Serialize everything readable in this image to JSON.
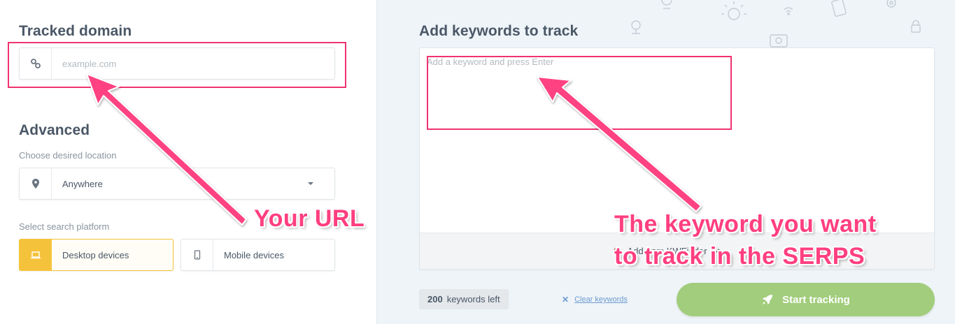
{
  "left": {
    "tracked_title": "Tracked domain",
    "domain_placeholder": "example.com",
    "advanced_title": "Advanced",
    "location_label": "Choose desired location",
    "location_value": "Anywhere",
    "platform_label": "Select search platform",
    "platforms": [
      {
        "label": "Desktop devices",
        "active": true
      },
      {
        "label": "Mobile devices",
        "active": false
      }
    ]
  },
  "right": {
    "keywords_title": "Add keywords to track",
    "keyword_placeholder": "Add a keyword and press Enter",
    "add_from_label": "Add from KWFinder",
    "keywords_left_count": "200",
    "keywords_left_label": "keywords left",
    "clear_label": "Clear keywords",
    "start_label": "Start tracking"
  },
  "annotations": {
    "url_callout": "Your URL",
    "keyword_callout_line1": "The keyword you want",
    "keyword_callout_line2": "to track in the SERPS",
    "color": "#f0336f"
  },
  "colors": {
    "accent_yellow": "#f5c33b",
    "start_green": "#a2cd7c",
    "link_blue": "#6d9bd1"
  }
}
